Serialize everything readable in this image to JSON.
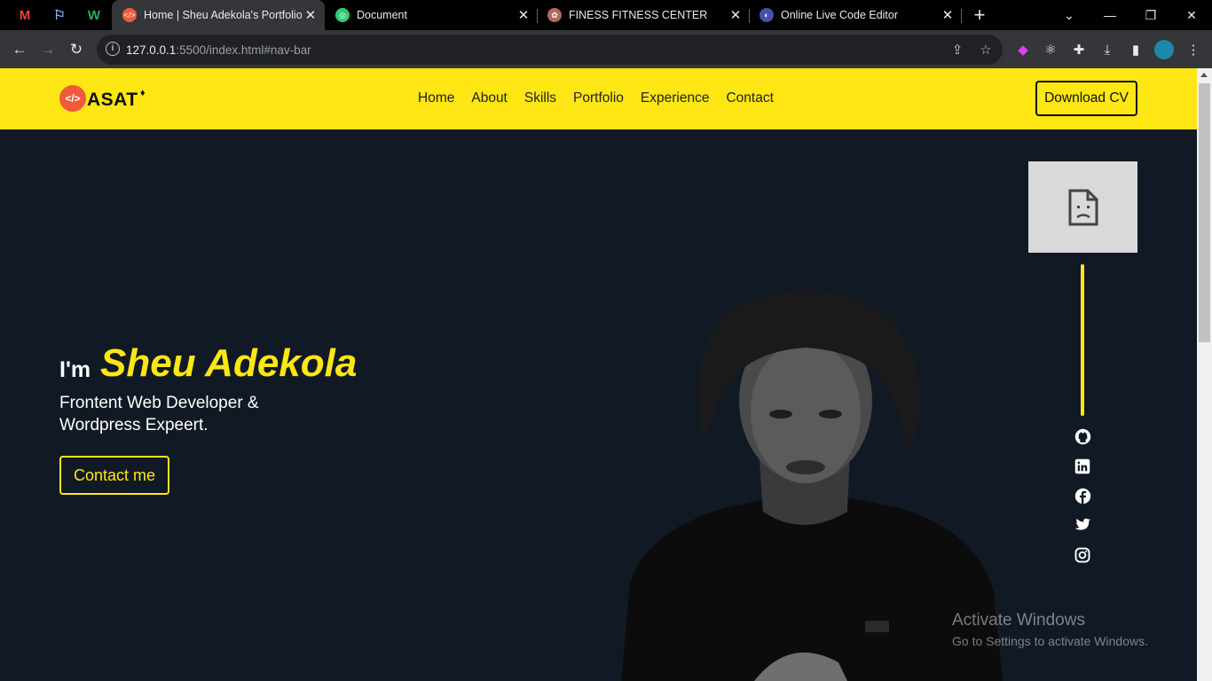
{
  "browser": {
    "tabs": [
      {
        "title": "Home | Sheu Adekola's Portfolio",
        "active": true
      },
      {
        "title": "Document",
        "active": false
      },
      {
        "title": "FINESS FITNESS CENTER",
        "active": false
      },
      {
        "title": "Online Live Code Editor",
        "active": false
      }
    ],
    "close_glyph": "✕",
    "new_tab_glyph": "+",
    "url_host": "127.0.0.1",
    "url_rest": ":5500/index.html#nav-bar",
    "pinned_icons": [
      "gmail-icon",
      "flag-icon",
      "w-icon"
    ]
  },
  "site": {
    "logo_text": "ASAT",
    "logo_sup": "♦",
    "nav": [
      "Home",
      "About",
      "Skills",
      "Portfolio",
      "Experience",
      "Contact"
    ],
    "cv_button": "Download CV",
    "hero": {
      "intro": "I'm",
      "name": "Sheu Adekola",
      "subtitle": "Frontent Web Developer & Wordpress Expeert.",
      "contact_button": "Contact me"
    },
    "socials": [
      "github-icon",
      "linkedin-icon",
      "facebook-icon",
      "twitter-icon",
      "instagram-icon"
    ],
    "accent_color": "#ffe615",
    "bg_color": "#111a24"
  },
  "watermark": {
    "line1": "Activate Windows",
    "line2": "Go to Settings to activate Windows."
  }
}
